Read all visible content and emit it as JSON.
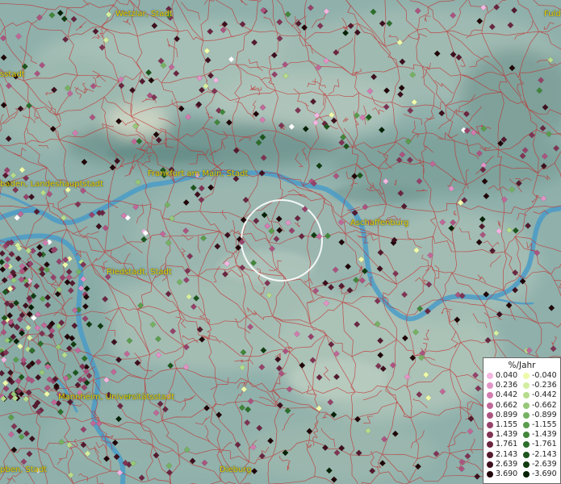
{
  "legend": {
    "title": "%/Jahr",
    "positive": [
      {
        "label": "0.040",
        "color": "#f2b6e0"
      },
      {
        "label": "0.236",
        "color": "#e294c6"
      },
      {
        "label": "0.442",
        "color": "#d27cb0"
      },
      {
        "label": "0.662",
        "color": "#c06898"
      },
      {
        "label": "0.899",
        "color": "#ac5480"
      },
      {
        "label": "1.155",
        "color": "#96426a"
      },
      {
        "label": "1.439",
        "color": "#803454"
      },
      {
        "label": "1.761",
        "color": "#6a2640"
      },
      {
        "label": "2.143",
        "color": "#541a2e"
      },
      {
        "label": "2.639",
        "color": "#3e101e"
      },
      {
        "label": "3.690",
        "color": "#200608"
      }
    ],
    "negative": [
      {
        "label": "-0.040",
        "color": "#eefaaa"
      },
      {
        "label": "-0.236",
        "color": "#d4eea0"
      },
      {
        "label": "-0.442",
        "color": "#b6dc8c"
      },
      {
        "label": "-0.662",
        "color": "#96c878"
      },
      {
        "label": "-0.899",
        "color": "#76b262"
      },
      {
        "label": "-1.155",
        "color": "#5a9c4c"
      },
      {
        "label": "-1.439",
        "color": "#42863a"
      },
      {
        "label": "-1.761",
        "color": "#2c6e2a"
      },
      {
        "label": "-2.143",
        "color": "#1c561c"
      },
      {
        "label": "-2.639",
        "color": "#103c10"
      },
      {
        "label": "-3.690",
        "color": "#062206"
      }
    ]
  },
  "cities": [
    {
      "name": "Wetzlar, Stadt"
    },
    {
      "name": "Fuld"
    },
    {
      "name": "sstadt"
    },
    {
      "name": "baden, Landeshauptstadt"
    },
    {
      "name": "Frankfurt am Main, Stadt"
    },
    {
      "name": "Aschaffenburg"
    },
    {
      "name": "Riedstadt, Stadt"
    },
    {
      "name": "Mannheim, Universitätsstadt"
    },
    {
      "name": "Dieburg"
    },
    {
      "name": "pben, Stadt"
    }
  ]
}
